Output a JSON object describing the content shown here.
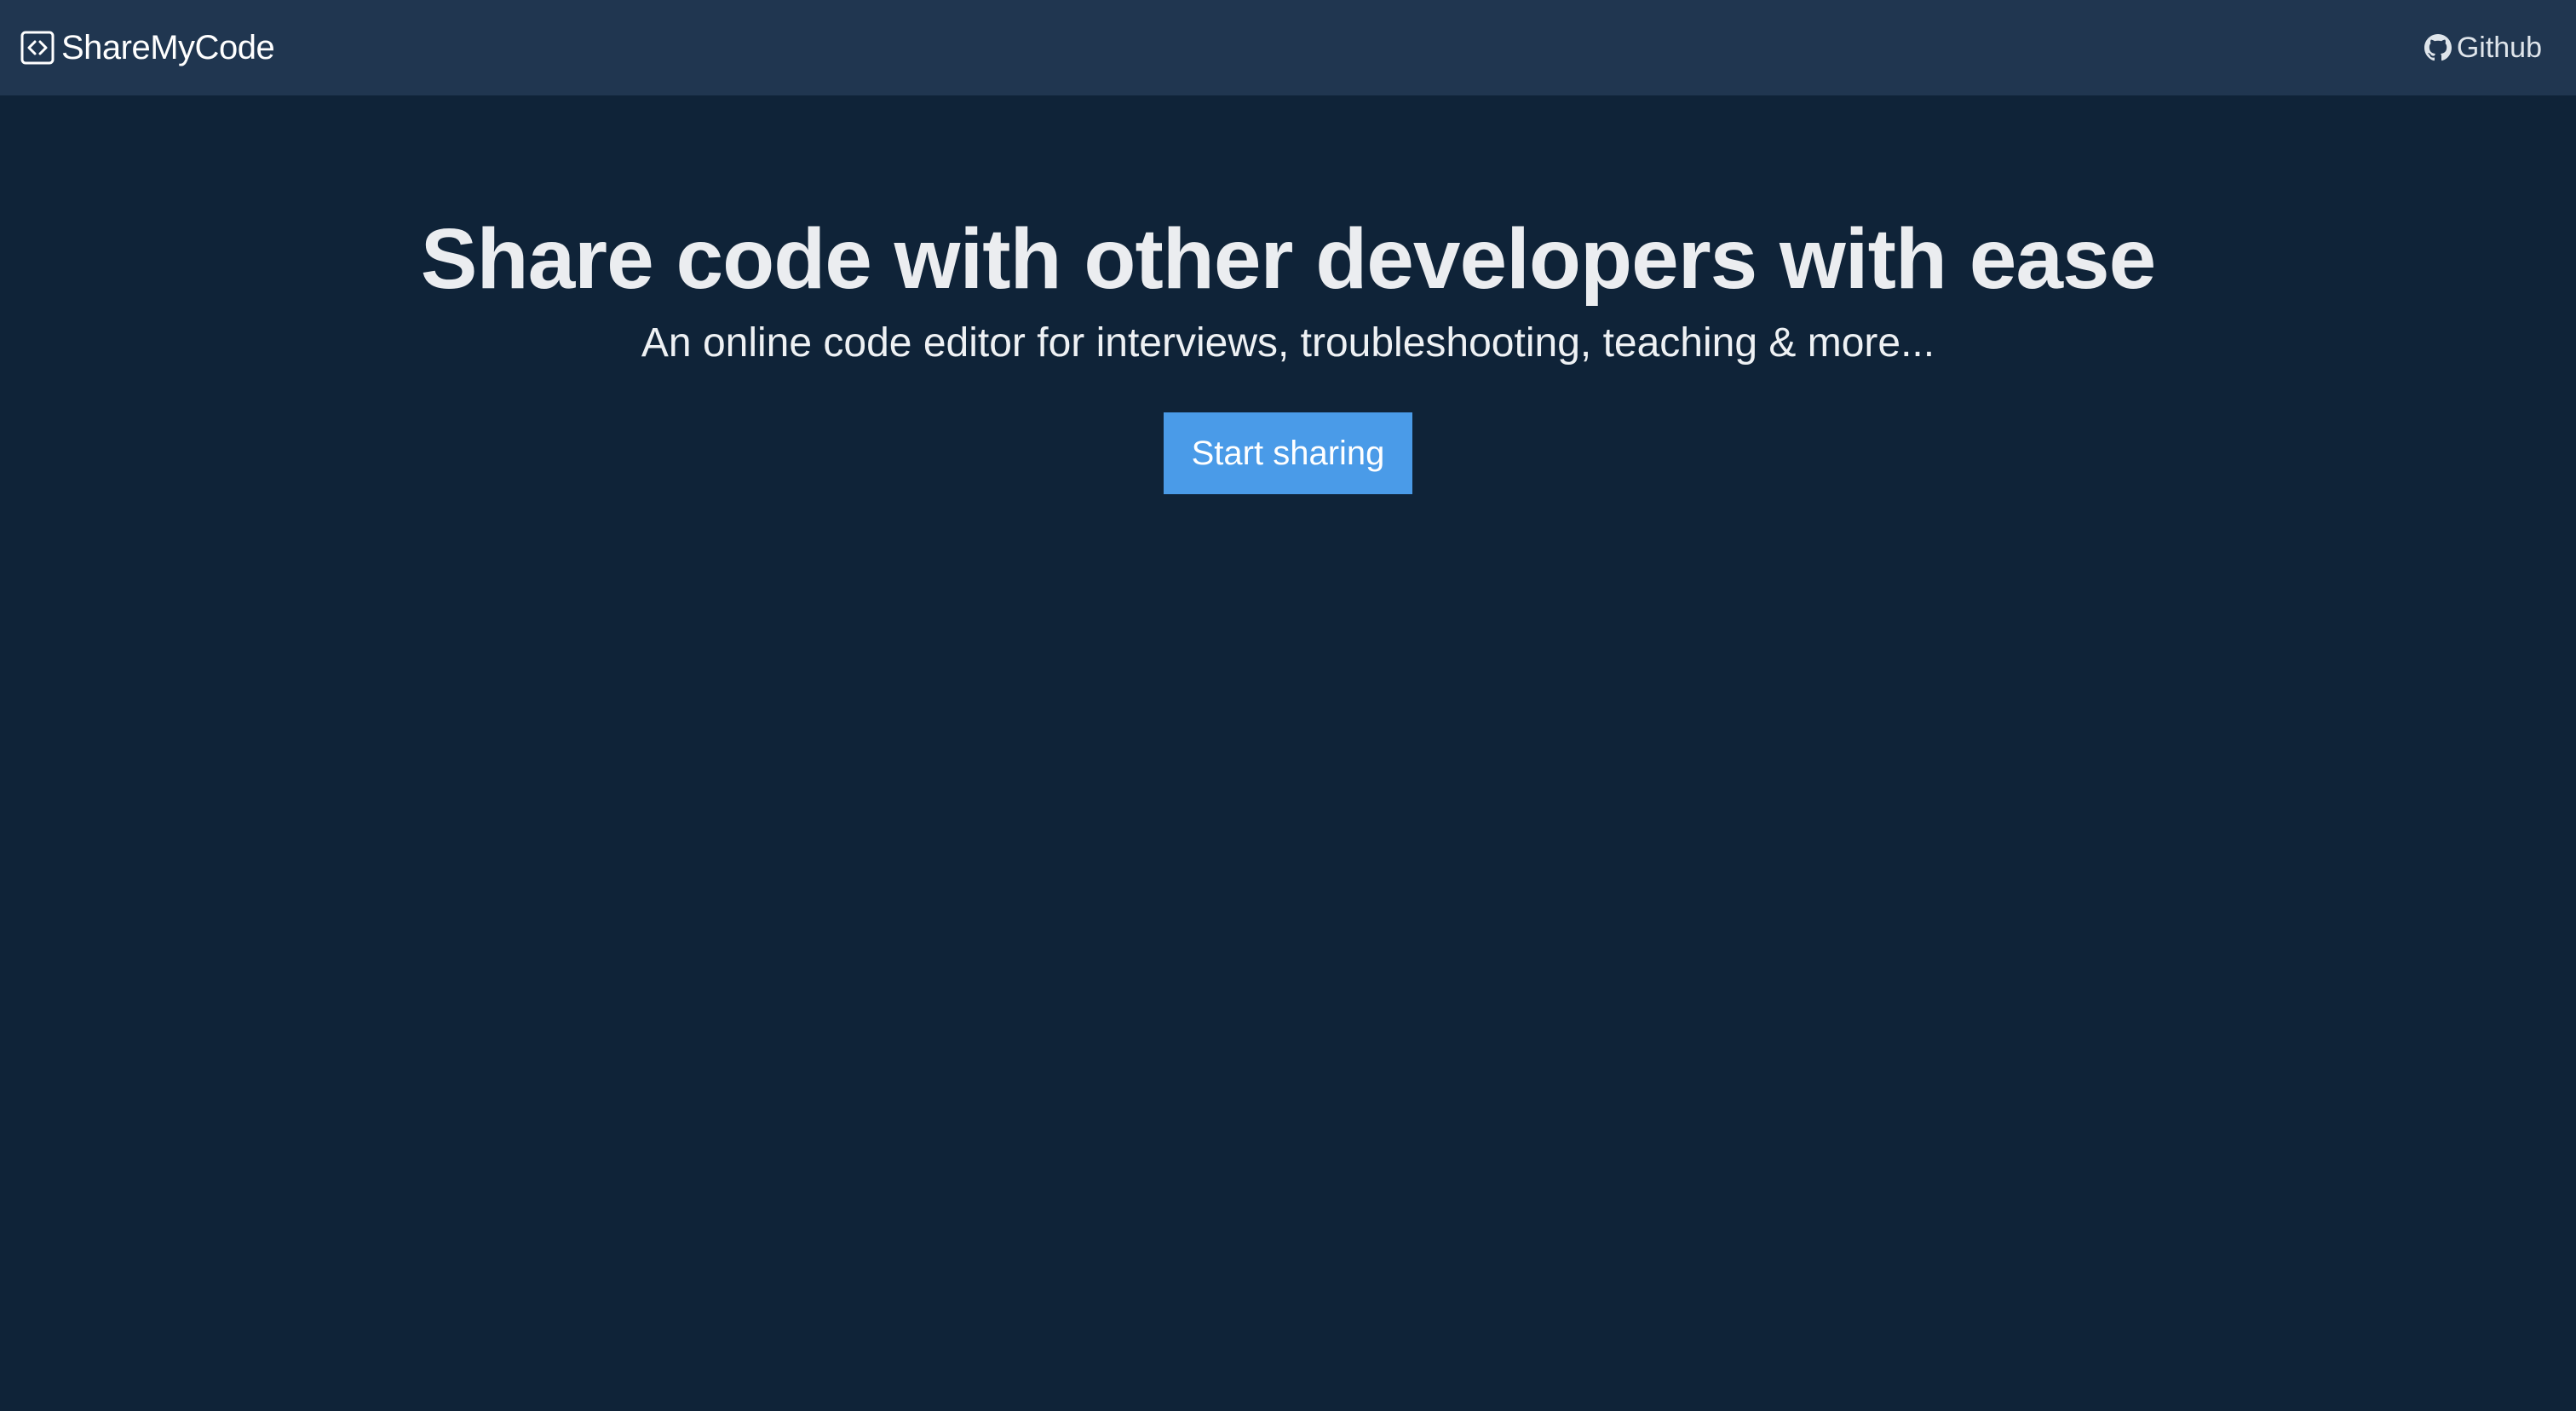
{
  "navbar": {
    "brand_icon": "code-brackets-icon",
    "brand_label": "ShareMyCode",
    "github_icon": "github-icon",
    "github_label": "Github"
  },
  "hero": {
    "title": "Share code with other developers with ease",
    "subtitle": "An online code editor for interviews, troubleshooting, teaching & more...",
    "cta_label": "Start sharing"
  },
  "colors": {
    "background": "#0f2338",
    "navbar": "#203650",
    "accent": "#4a9be8",
    "text": "#eef1f4"
  }
}
